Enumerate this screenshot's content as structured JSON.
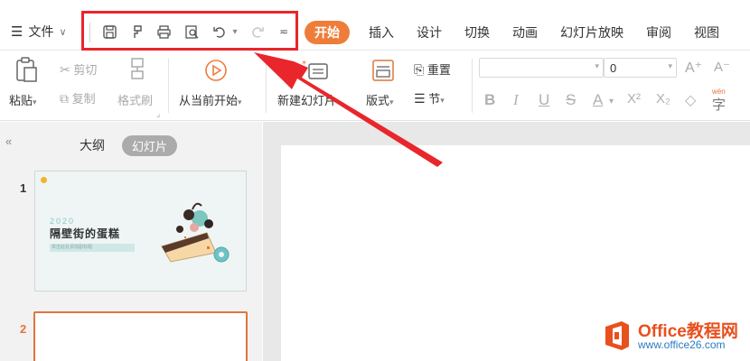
{
  "titlebar": {
    "file_label": "文件",
    "tabs": [
      "开始",
      "插入",
      "设计",
      "切换",
      "动画",
      "幻灯片放映",
      "审阅",
      "视图"
    ]
  },
  "quick_access": {
    "icons": [
      "save-icon",
      "format-painter-icon",
      "print-icon",
      "print-preview-icon",
      "undo-icon",
      "redo-icon",
      "customize-icon"
    ]
  },
  "ribbon": {
    "paste": "粘贴",
    "cut": "剪切",
    "copy": "复制",
    "format_painter": "格式刷",
    "from_current": "从当前开始",
    "new_slide": "新建幻灯片",
    "layout": "版式",
    "reset": "重置",
    "section": "节",
    "font_size": "0",
    "font_grow": "A⁺",
    "font_shrink": "A⁻",
    "bold": "B",
    "italic": "I",
    "underline": "U",
    "strikethrough": "S",
    "font_color": "A",
    "superscript": "X²",
    "subscript": "X₂",
    "pinyin": "wén"
  },
  "left_panel": {
    "outline_tab": "大纲",
    "slides_tab": "幻灯片",
    "slides": [
      {
        "number": "1",
        "year": "2020",
        "title": "隔壁街的蛋糕",
        "subtitle": "单击此处添加副标题"
      },
      {
        "number": "2"
      }
    ]
  },
  "watermark": {
    "title": "Office教程网",
    "url": "www.office26.com"
  },
  "colors": {
    "accent": "#ee7d3a",
    "highlight_red": "#e8262b",
    "watermark_orange": "#e8501e",
    "watermark_blue": "#2a7bc4"
  }
}
